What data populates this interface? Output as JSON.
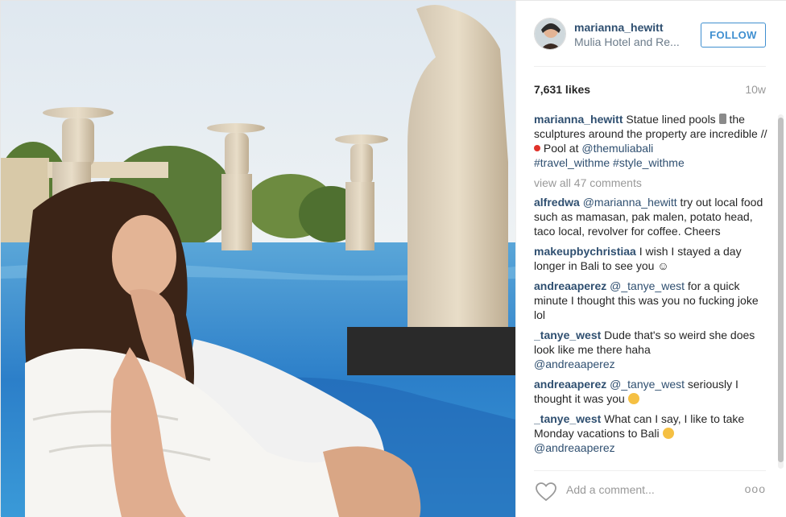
{
  "post": {
    "username": "marianna_hewitt",
    "location": "Mulia Hotel and Re...",
    "follow_label": "FOLLOW",
    "likes": "7,631 likes",
    "age": "10w"
  },
  "caption": {
    "user": "marianna_hewitt",
    "text_1": " Statue lined pools ",
    "text_2": " the sculptures around the property are incredible // ",
    "text_3": " Pool at ",
    "mention": "@themuliabali",
    "tags": "#travel_withme #style_withme"
  },
  "view_all": "view all 47 comments",
  "comments": [
    {
      "user": "alfredwa",
      "mention": "@marianna_hewitt",
      "text": " try out local food such as mamasan, pak malen, potato head, taco local, revolver for coffee. Cheers"
    },
    {
      "user": "makeupbychristiaa",
      "mention": "",
      "text": " I wish I stayed a day longer in Bali to see you ☺"
    },
    {
      "user": "andreaaperez",
      "mention": "@_tanye_west",
      "text": " for a quick minute I thought this was you no fucking joke lol"
    },
    {
      "user": "_tanye_west",
      "mention": "",
      "text": " Dude that's so weird she does look like me there haha ",
      "mention2": "@andreaaperez"
    },
    {
      "user": "andreaaperez",
      "mention": "@_tanye_west",
      "text": " seriously I thought it was you"
    },
    {
      "user": "_tanye_west",
      "mention": "",
      "text": " What can I say, I like to take Monday vacations to Bali",
      "mention2": "@andreaaperez"
    }
  ],
  "footer": {
    "add_comment_placeholder": "Add a comment...",
    "more_label": "ooo"
  },
  "icons": {
    "heart": "heart-icon",
    "more": "more-options-icon",
    "avatar": "avatar"
  },
  "colors": {
    "link": "#2f4f70",
    "follow": "#3f8fd0",
    "muted": "#999999"
  }
}
